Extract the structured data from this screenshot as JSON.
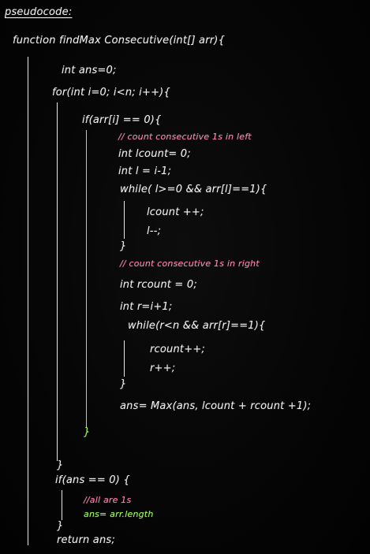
{
  "title": "pseudocode:",
  "signature": "function findMax Consecutive(int[] arr){",
  "lines": {
    "ans_init": "int ans=0;",
    "for_loop": "for(int i=0; i<n; i++){",
    "if_zero": "if(arr[i] == 0){",
    "comment_left": "// count consecutive 1s in left",
    "lcount_init": "int lcount= 0;",
    "l_init": "int l = i-1;",
    "while_left": "while( l>=0 && arr[l]==1){",
    "lcount_inc": "lcount ++;",
    "l_dec": "l--;",
    "close_while_left": "}",
    "comment_right": "// count consecutive 1s in right",
    "rcount_init": "int rcount = 0;",
    "r_init": "int r=i+1;",
    "while_right": "while(r<n && arr[r]==1){",
    "rcount_inc": "rcount++;",
    "r_inc": "r++;",
    "close_while_right": "}",
    "ans_update": "ans= Max(ans, lcount + rcount +1);",
    "close_if": "}",
    "close_for": "}",
    "if_ans_zero": "if(ans == 0) {",
    "comment_all_ones": "//all are 1s",
    "ans_length": "ans= arr.length",
    "close_if_ans": "}",
    "return": "return ans;"
  },
  "colors": {
    "code": "#ececec",
    "comment": "#ff7fa8",
    "highlight": "#9cff57",
    "background": "#050505"
  }
}
